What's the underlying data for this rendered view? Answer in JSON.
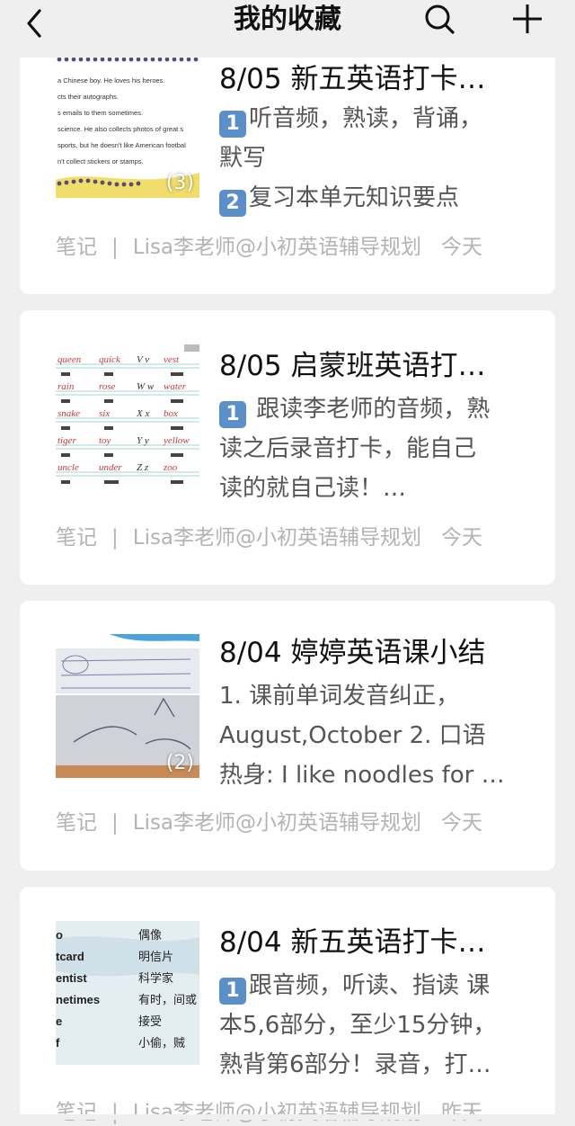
{
  "nav": {
    "title": "我的收藏"
  },
  "cards": [
    {
      "title": "8/05 新五英语打卡…",
      "lines": [
        "听音频，熟读，背诵，",
        "默写",
        "复习本单元知识要点"
      ],
      "badges": [
        "1",
        "",
        "2"
      ],
      "image_count": "(3)",
      "thumb_lines": [
        "a Chinese boy. He loves his heroes.",
        "cts their autographs.",
        "s emails to them sometimes.",
        "science. He also collects photos of great s",
        "sports, but he doesn't like American footbal",
        "n't collect stickers or stamps."
      ],
      "type": "笔记",
      "author": "Lisa李老师@小初英语辅导规划",
      "time": "今天"
    },
    {
      "title": "8/05 启蒙班英语打…",
      "lines": [
        " 跟读李老师的音频，熟",
        "读之后录音打卡，能自己",
        "读的就自己读！…"
      ],
      "badges": [
        "1",
        "",
        ""
      ],
      "thumb_words": [
        "queen",
        "quick",
        "V v",
        "vest",
        "rain",
        "rose",
        "W w",
        "water",
        "snake",
        "six",
        "X x",
        "box",
        "tiger",
        "toy",
        "Y y",
        "yellow",
        "uncle",
        "under",
        "Z z",
        "zoo"
      ],
      "type": "笔记",
      "author": "Lisa李老师@小初英语辅导规划",
      "time": "今天"
    },
    {
      "title": "8/04 婷婷英语课小结",
      "lines": [
        "1. 课前单词发音纠正，",
        "August,October  2. 口语",
        "热身: I like noodles for …"
      ],
      "badges": [
        "",
        "",
        ""
      ],
      "image_count": "(2)",
      "type": "笔记",
      "author": "Lisa李老师@小初英语辅导规划",
      "time": "今天"
    },
    {
      "title": "8/04 新五英语打卡…",
      "lines": [
        "跟音频，听读、指读 课",
        "本5,6部分，至少15分钟，",
        "熟背第6部分！录音，打…"
      ],
      "badges": [
        "1",
        "",
        ""
      ],
      "thumb_rows": [
        [
          "o",
          "偶像"
        ],
        [
          "tcard",
          "明信片"
        ],
        [
          "entist",
          "科学家"
        ],
        [
          "netimes",
          "有时，间或"
        ],
        [
          "e",
          "接受"
        ],
        [
          "f",
          "小偷，贼"
        ]
      ],
      "type": "笔记",
      "author": "Lisa李老师@小初英语辅导规划",
      "time": "昨天"
    }
  ]
}
